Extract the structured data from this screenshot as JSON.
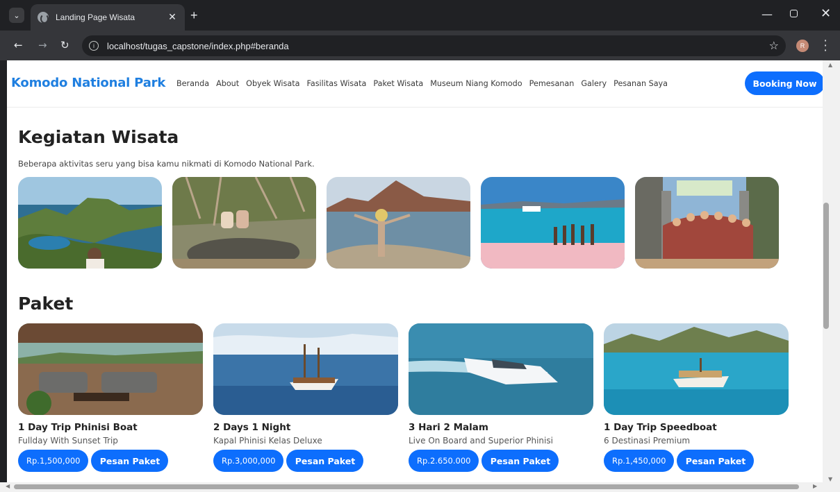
{
  "browser": {
    "tab_title": "Landing Page Wisata",
    "url": "localhost/tugas_capstone/index.php#beranda",
    "profile_initial": "R"
  },
  "site": {
    "brand": "Komodo National Park",
    "nav": [
      "Beranda",
      "About",
      "Obyek Wisata",
      "Fasilitas Wisata",
      "Paket Wisata",
      "Museum Niang Komodo",
      "Pemesanan",
      "Galery",
      "Pesanan Saya"
    ],
    "booking_label": "Booking Now",
    "accent": "#0d6efd"
  },
  "kegiatan": {
    "title": "Kegiatan Wisata",
    "desc": "Beberapa aktivitas seru yang bisa kamu nikmati di Komodo National Park."
  },
  "paket": {
    "title": "Paket",
    "order_label": "Pesan Paket",
    "items": [
      {
        "name": "1 Day Trip Phinisi Boat",
        "sub": "Fullday With Sunset Trip",
        "price": "Rp.1,500,000"
      },
      {
        "name": "2 Days 1 Night",
        "sub": "Kapal Phinisi Kelas Deluxe",
        "price": "Rp.3,000,000"
      },
      {
        "name": "3 Hari 2 Malam",
        "sub": "Live On Board and Superior Phinisi",
        "price": "Rp.2.650.000"
      },
      {
        "name": "1 Day Trip Speedboat",
        "sub": "6 Destinasi Premium",
        "price": "Rp.1,450,000"
      }
    ]
  }
}
